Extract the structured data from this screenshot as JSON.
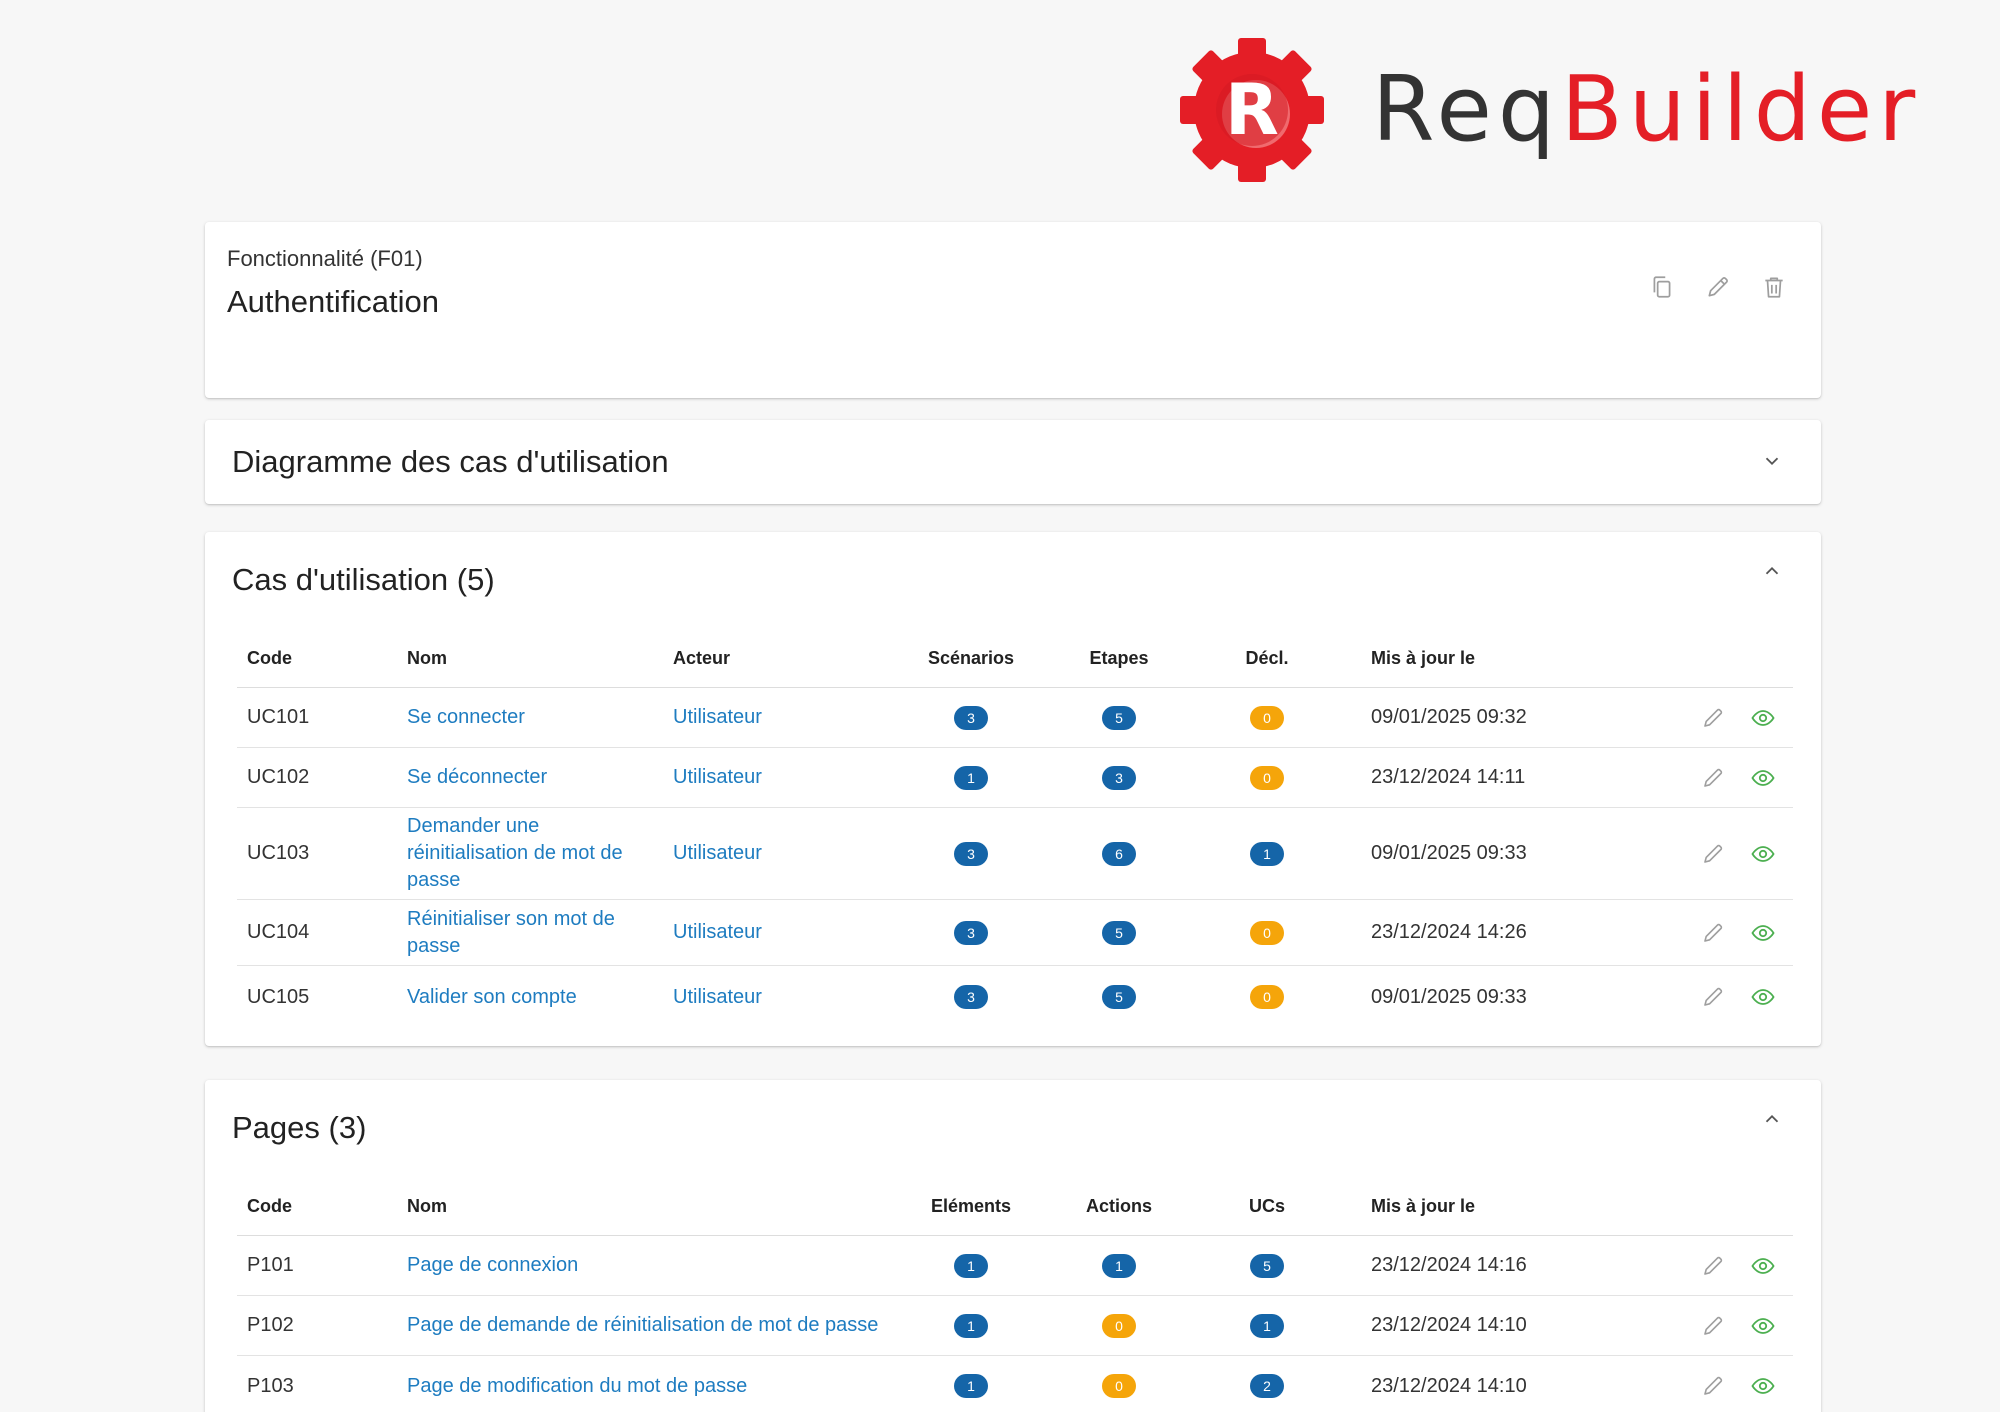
{
  "brand": {
    "mark_letter": "R",
    "name_part1": "Req",
    "name_part2": "Builder",
    "red": "#e41e26",
    "dark": "#333333"
  },
  "feature": {
    "subtitle": "Fonctionnalité (F01)",
    "title": "Authentification",
    "icons": [
      "copy-icon",
      "pencil-icon",
      "trash-icon"
    ]
  },
  "diagram": {
    "title": "Diagramme des cas d'utilisation"
  },
  "use_cases": {
    "title": "Cas d'utilisation (5)",
    "headers": {
      "code": "Code",
      "nom": "Nom",
      "acteur": "Acteur",
      "scenarios": "Scénarios",
      "etapes": "Etapes",
      "decl": "Décl.",
      "updated": "Mis à jour le"
    },
    "rows": [
      {
        "code": "UC101",
        "nom": "Se connecter",
        "acteur": "Utilisateur",
        "scenarios": "3",
        "etapes": "5",
        "decl": "0",
        "updated": "09/01/2025 09:32"
      },
      {
        "code": "UC102",
        "nom": "Se déconnecter",
        "acteur": "Utilisateur",
        "scenarios": "1",
        "etapes": "3",
        "decl": "0",
        "updated": "23/12/2024 14:11"
      },
      {
        "code": "UC103",
        "nom": "Demander une réinitialisation de mot de passe",
        "acteur": "Utilisateur",
        "scenarios": "3",
        "etapes": "6",
        "decl": "1",
        "updated": "09/01/2025 09:33"
      },
      {
        "code": "UC104",
        "nom": "Réinitialiser son mot de passe",
        "acteur": "Utilisateur",
        "scenarios": "3",
        "etapes": "5",
        "decl": "0",
        "updated": "23/12/2024 14:26"
      },
      {
        "code": "UC105",
        "nom": "Valider son compte",
        "acteur": "Utilisateur",
        "scenarios": "3",
        "etapes": "5",
        "decl": "0",
        "updated": "09/01/2025 09:33"
      }
    ]
  },
  "pages": {
    "title": "Pages (3)",
    "headers": {
      "code": "Code",
      "nom": "Nom",
      "elements": "Eléments",
      "actions": "Actions",
      "ucs": "UCs",
      "updated": "Mis à jour le"
    },
    "rows": [
      {
        "code": "P101",
        "nom": "Page de connexion",
        "elements": "1",
        "actions": "1",
        "ucs": "5",
        "updated": "23/12/2024 14:16"
      },
      {
        "code": "P102",
        "nom": "Page de demande de réinitialisation de mot de passe",
        "elements": "1",
        "actions": "0",
        "ucs": "1",
        "updated": "23/12/2024 14:10"
      },
      {
        "code": "P103",
        "nom": "Page de modification du mot de passe",
        "elements": "1",
        "actions": "0",
        "ucs": "2",
        "updated": "23/12/2024 14:10"
      }
    ]
  },
  "colors": {
    "link": "#1e7cc0",
    "badge_blue": "#1565a8",
    "badge_orange": "#f5a50a",
    "eye_green": "#4caf50",
    "icon_gray": "#9e9e9e"
  }
}
